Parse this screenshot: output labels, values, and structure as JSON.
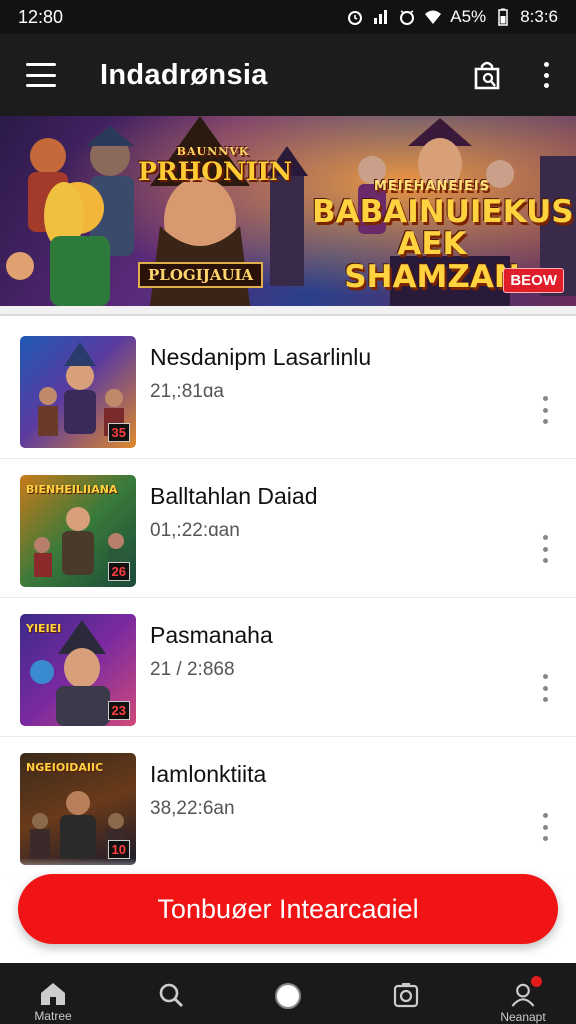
{
  "status_bar": {
    "time": "12:80",
    "battery_pct": "A5%",
    "clock_right": "8:3:6"
  },
  "app_bar": {
    "title": "Indadrønsia"
  },
  "banner": {
    "title_left_small": "BAUNNVK",
    "title_left": "PRHONIIN",
    "tag": "PLOGIJAUIA",
    "title_right_small": "MEIEHANEIEIS",
    "title_right": "BABAINUIEKUS AEK SHAMZAN",
    "badge": "BEOW"
  },
  "games": [
    {
      "title": "Nesdanipm Lasarlinlu",
      "subtitle": "21,:81ɑa",
      "thumb_label": "",
      "thumb_num": "35"
    },
    {
      "title": "Balltahlan Daiad",
      "subtitle": "01,:22:ɑan",
      "thumb_label": "BIENHEILIIANA",
      "thumb_num": "26"
    },
    {
      "title": "Pasmanaha",
      "subtitle": "21 / 2:868",
      "thumb_label": "YIEIEI",
      "thumb_num": "23"
    },
    {
      "title": "Iamlonktiita",
      "subtitle": "38,22:6an",
      "thumb_label": "NGEIOIDAIIC",
      "thumb_num": "10"
    }
  ],
  "cta": {
    "label": "Tonbuøer Intearcaɑiel"
  },
  "bottom_nav": [
    {
      "label": "Matree",
      "icon": "home-icon"
    },
    {
      "label": "",
      "icon": "search-icon"
    },
    {
      "label": "",
      "icon": "circle-icon"
    },
    {
      "label": "",
      "icon": "camera-icon"
    },
    {
      "label": "Neanapt",
      "icon": "profile-icon"
    }
  ],
  "colors": {
    "accent": "#f01414",
    "appbar": "#1c1c1c",
    "statusbar": "#121212",
    "bottomnav": "#1a1a1a"
  }
}
